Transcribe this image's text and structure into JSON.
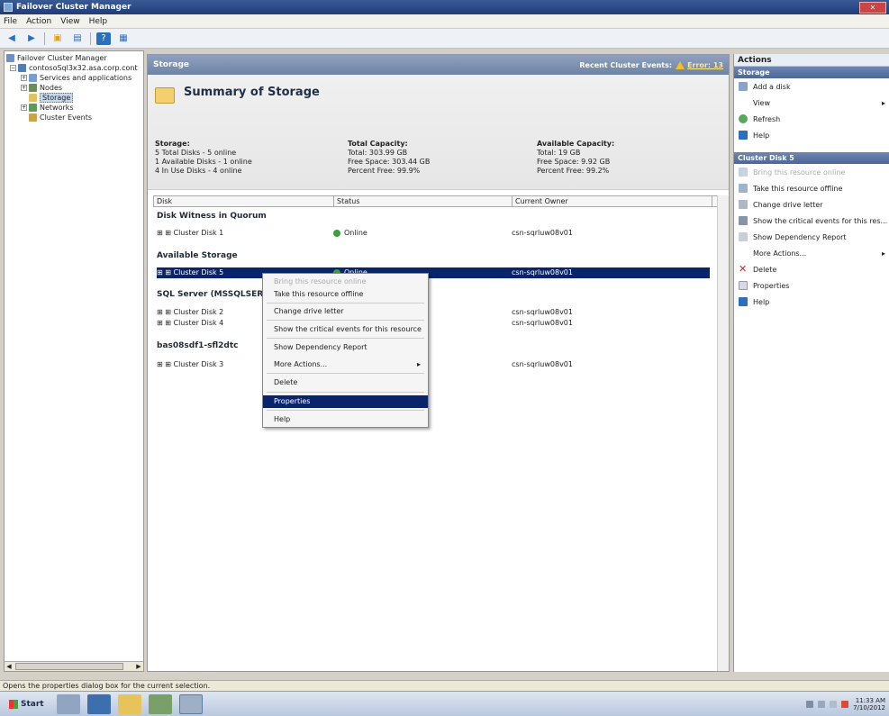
{
  "window": {
    "title": "Failover Cluster Manager",
    "close_label": "✕"
  },
  "menu": [
    "File",
    "Action",
    "View",
    "Help"
  ],
  "toolbar": {
    "icons": [
      "back-arrow-icon",
      "forward-arrow-icon",
      "up-folder-icon",
      "properties-icon",
      "help-icon",
      "show-hide-icon"
    ]
  },
  "tree": {
    "items": [
      {
        "label": "Failover Cluster Manager",
        "level": 0,
        "icon": "cluster-manager-icon",
        "expander": ""
      },
      {
        "label": "contosoSql3x32.asa.corp.cont",
        "level": 1,
        "icon": "cluster-icon",
        "expander": "−"
      },
      {
        "label": "Services and applications",
        "level": 2,
        "icon": "services-icon",
        "expander": "+"
      },
      {
        "label": "Nodes",
        "level": 2,
        "icon": "nodes-icon",
        "expander": "+"
      },
      {
        "label": "Storage",
        "level": 2,
        "icon": "storage-icon",
        "expander": "",
        "selected": true
      },
      {
        "label": "Networks",
        "level": 2,
        "icon": "networks-icon",
        "expander": "+"
      },
      {
        "label": "Cluster Events",
        "level": 2,
        "icon": "events-icon",
        "expander": ""
      }
    ]
  },
  "center": {
    "header": "Storage",
    "recent_events_label": "Recent Cluster Events:",
    "recent_events_link": "Error: 13",
    "summary_title": "Summary of Storage",
    "storage": {
      "heading": "Storage:",
      "lines": [
        "5 Total Disks - 5 online",
        "1 Available Disks - 1 online",
        "4 In Use Disks - 4 online"
      ]
    },
    "total": {
      "heading": "Total Capacity:",
      "lines": [
        "Total: 303.99 GB",
        "Free Space: 303.44 GB",
        "Percent Free: 99.9%"
      ]
    },
    "available": {
      "heading": "Available Capacity:",
      "lines": [
        "Total: 19 GB",
        "Free Space: 9.92 GB",
        "Percent Free: 99.2%"
      ]
    },
    "columns": [
      "Disk",
      "Status",
      "Current Owner"
    ],
    "groups": [
      {
        "name": "Disk Witness in Quorum",
        "rows": [
          {
            "disk": "⊞ ⊞ Cluster Disk 1",
            "status": "Online",
            "owner": "csn-sqrluw08v01"
          }
        ]
      },
      {
        "name": "Available Storage",
        "rows": [
          {
            "disk": "⊞ ⊞ Cluster Disk 5",
            "status": "Online",
            "owner": "csn-sqrluw08v01",
            "selected": true
          }
        ]
      },
      {
        "name": "SQL Server (MSSQLSERVER)",
        "rows": [
          {
            "disk": "⊞ ⊞ Cluster Disk 2",
            "status": "",
            "owner": "csn-sqrluw08v01"
          },
          {
            "disk": "⊞ ⊞ Cluster Disk 4",
            "status": "",
            "owner": "csn-sqrluw08v01"
          }
        ]
      },
      {
        "name": "bas08sdf1-sfl2dtc",
        "rows": [
          {
            "disk": "⊞ ⊞ Cluster Disk 3",
            "status": "",
            "owner": "csn-sqrluw08v01"
          }
        ]
      }
    ]
  },
  "context_menu": {
    "items": [
      {
        "label": "Bring this resource online",
        "disabled": true
      },
      {
        "label": "Take this resource offline"
      },
      {
        "label": "Change drive letter"
      },
      {
        "label": "Show the critical events for this resource"
      },
      {
        "label": "Show Dependency Report"
      },
      {
        "label": "More Actions...",
        "submenu": "▸"
      },
      {
        "label": "Delete"
      },
      {
        "label": "Properties",
        "highlighted": true
      },
      {
        "label": "Help"
      }
    ]
  },
  "actions": {
    "title": "Actions",
    "sections": [
      {
        "name": "Storage",
        "items": [
          {
            "label": "Add a disk",
            "icon": "add-disk-icon"
          },
          {
            "label": "View",
            "icon": "",
            "submenu": "▸"
          },
          {
            "label": "Refresh",
            "icon": "refresh-icon"
          },
          {
            "label": "Help",
            "icon": "help-icon"
          }
        ]
      },
      {
        "name": "Cluster Disk 5",
        "items": [
          {
            "label": "Bring this resource online",
            "icon": "online-icon",
            "disabled": true
          },
          {
            "label": "Take this resource offline",
            "icon": "offline-icon"
          },
          {
            "label": "Change drive letter",
            "icon": "drive-letter-icon"
          },
          {
            "label": "Show the critical events for this res...",
            "icon": "critical-events-icon"
          },
          {
            "label": "Show Dependency Report",
            "icon": "dependency-report-icon"
          },
          {
            "label": "More Actions...",
            "icon": "",
            "submenu": "▸"
          },
          {
            "label": "Delete",
            "icon": "delete-icon"
          },
          {
            "label": "Properties",
            "icon": "properties-icon"
          },
          {
            "label": "Help",
            "icon": "help-icon"
          }
        ]
      }
    ]
  },
  "status_bar": "Opens the properties dialog box for the current selection.",
  "taskbar": {
    "start_label": "Start",
    "clock_time": "11:33 AM",
    "clock_date": "7/10/2012"
  }
}
